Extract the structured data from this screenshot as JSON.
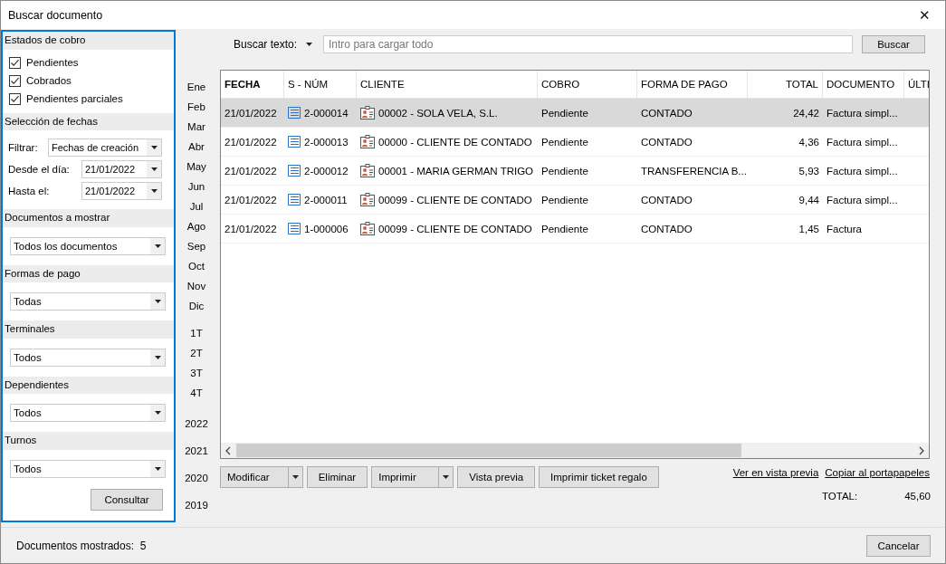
{
  "window": {
    "title": "Buscar documento",
    "close": "✕"
  },
  "sidebar": {
    "estados": {
      "title": "Estados de cobro",
      "items": [
        {
          "label": "Pendientes",
          "checked": true
        },
        {
          "label": "Cobrados",
          "checked": true
        },
        {
          "label": "Pendientes parciales",
          "checked": true
        }
      ]
    },
    "fechas": {
      "title": "Selección de fechas",
      "fields": [
        {
          "label": "Filtrar:",
          "value": "Fechas de creación"
        },
        {
          "label": "Desde el día:",
          "value": "21/01/2022"
        },
        {
          "label": "Hasta el:",
          "value": "21/01/2022"
        }
      ]
    },
    "selects": [
      {
        "title": "Documentos a mostrar",
        "value": "Todos los documentos"
      },
      {
        "title": "Formas de pago",
        "value": "Todas"
      },
      {
        "title": "Terminales",
        "value": "Todos"
      },
      {
        "title": "Dependientes",
        "value": "Todos"
      },
      {
        "title": "Turnos",
        "value": "Todos"
      }
    ],
    "button": "Consultar"
  },
  "periods": {
    "months": [
      "Ene",
      "Feb",
      "Mar",
      "Abr",
      "May",
      "Jun",
      "Jul",
      "Ago",
      "Sep",
      "Oct",
      "Nov",
      "Dic"
    ],
    "quarters": [
      "1T",
      "2T",
      "3T",
      "4T"
    ],
    "years": [
      "2022",
      "2021",
      "2020",
      "2019"
    ]
  },
  "search": {
    "label": "Buscar texto:",
    "placeholder": "Intro para cargar todo",
    "button": "Buscar"
  },
  "table": {
    "columns": [
      "FECHA",
      "S - NÚM",
      "CLIENTE",
      "COBRO",
      "FORMA DE PAGO",
      "TOTAL",
      "DOCUMENTO",
      "ÚLTI"
    ],
    "rows": [
      {
        "selected": true,
        "cells": [
          "21/01/2022",
          "2-000014",
          "00002 - SOLA VELA, S.L.",
          "Pendiente",
          "CONTADO",
          "24,42",
          "Factura simpl..."
        ]
      },
      {
        "selected": false,
        "cells": [
          "21/01/2022",
          "2-000013",
          "00000 - CLIENTE DE CONTADO",
          "Pendiente",
          "CONTADO",
          "4,36",
          "Factura simpl..."
        ]
      },
      {
        "selected": false,
        "cells": [
          "21/01/2022",
          "2-000012",
          "00001 - MARIA GERMAN TRIGO",
          "Pendiente",
          "TRANSFERENCIA B...",
          "5,93",
          "Factura simpl..."
        ]
      },
      {
        "selected": false,
        "cells": [
          "21/01/2022",
          "2-000011",
          "00099 - CLIENTE DE CONTADO",
          "Pendiente",
          "CONTADO",
          "9,44",
          "Factura simpl..."
        ]
      },
      {
        "selected": false,
        "cells": [
          "21/01/2022",
          "1-000006",
          "00099 - CLIENTE DE CONTADO",
          "Pendiente",
          "CONTADO",
          "1,45",
          "Factura"
        ]
      }
    ]
  },
  "actions": [
    {
      "label": "Modificar",
      "dropdown": true
    },
    {
      "label": "Eliminar",
      "dropdown": false
    },
    {
      "label": "Imprimir",
      "dropdown": true
    },
    {
      "label": "Vista previa",
      "dropdown": false
    },
    {
      "label": "Imprimir ticket regalo",
      "dropdown": false
    }
  ],
  "links": [
    "Ver en vista previa",
    "Copiar al portapapeles"
  ],
  "total": {
    "label": "TOTAL:",
    "value": "45,60"
  },
  "status": {
    "label": "Documentos mostrados:",
    "value": "5"
  },
  "cancel": "Cancelar"
}
